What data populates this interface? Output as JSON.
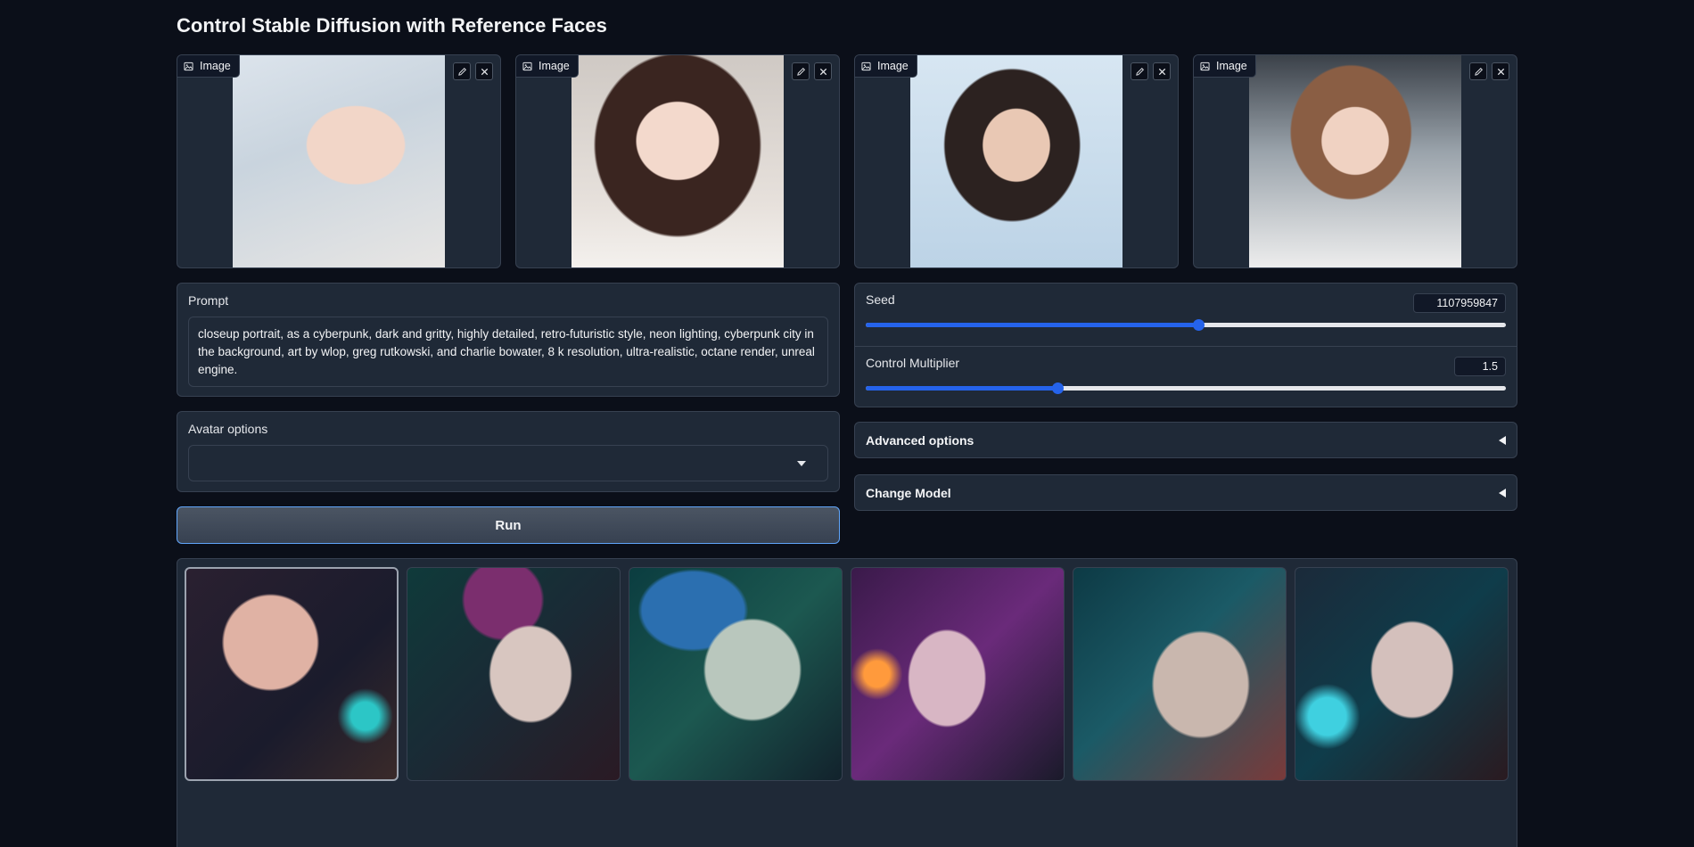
{
  "page": {
    "title": "Control Stable Diffusion with Reference Faces"
  },
  "reference_images": [
    {
      "label": "Image"
    },
    {
      "label": "Image"
    },
    {
      "label": "Image"
    },
    {
      "label": "Image"
    }
  ],
  "prompt": {
    "label": "Prompt",
    "value": "closeup portrait, as a cyberpunk, dark and gritty, highly detailed, retro-futuristic style, neon lighting, cyberpunk city in the background, art by wlop, greg rutkowski, and charlie bowater, 8 k resolution, ultra-realistic, octane render, unreal engine."
  },
  "avatar_options": {
    "label": "Avatar options",
    "selected": ""
  },
  "run_button": {
    "label": "Run"
  },
  "seed": {
    "label": "Seed",
    "value": "1107959847",
    "fraction": 0.52
  },
  "control_multiplier": {
    "label": "Control Multiplier",
    "value": "1.5",
    "fraction": 0.3
  },
  "advanced_options": {
    "label": "Advanced options"
  },
  "change_model": {
    "label": "Change Model"
  },
  "gallery": {
    "count": 6,
    "selected_index": 0
  },
  "colors": {
    "accent": "#2563eb",
    "background": "#0b0f19",
    "panel": "#1f2937",
    "border": "#374151"
  }
}
